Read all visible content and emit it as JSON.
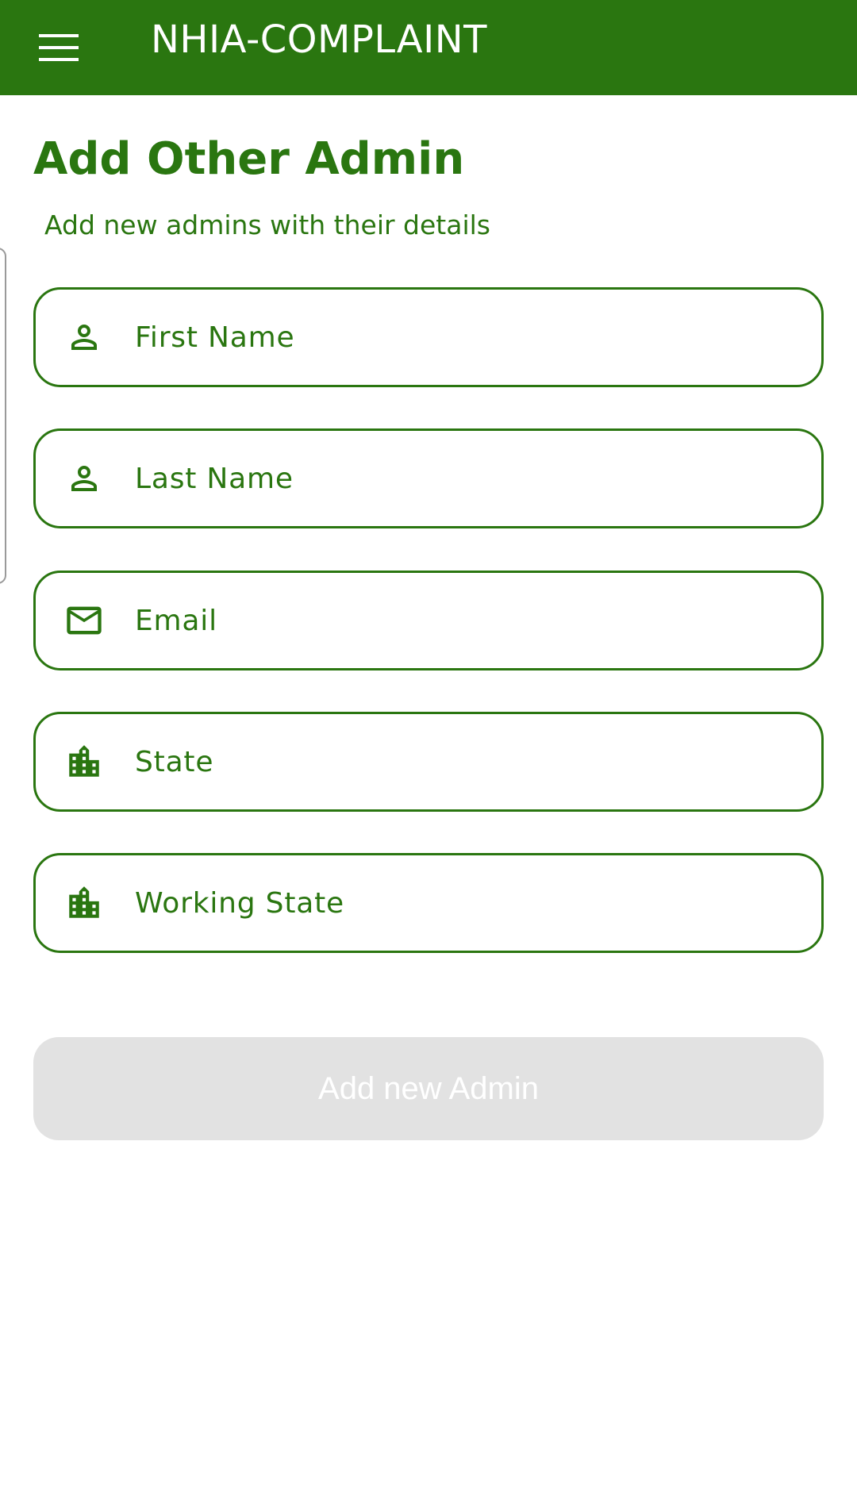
{
  "appbar": {
    "title": "NHIA-COMPLAINT",
    "menu_icon": "hamburger-menu-icon",
    "background": "#2a7610"
  },
  "page": {
    "title": "Add Other Admin",
    "subtitle": "Add new admins with their details"
  },
  "form": {
    "fields": [
      {
        "icon": "person-icon",
        "placeholder": "First Name",
        "value": ""
      },
      {
        "icon": "person-icon",
        "placeholder": "Last Name",
        "value": ""
      },
      {
        "icon": "mail-icon",
        "placeholder": "Email",
        "value": ""
      },
      {
        "icon": "city-icon",
        "placeholder": "State",
        "value": ""
      },
      {
        "icon": "city-icon",
        "placeholder": "Working State",
        "value": ""
      }
    ],
    "submit_label": "Add new Admin",
    "submit_state": "disabled"
  },
  "colors": {
    "accent": "#2a7610",
    "button_disabled": "#e2e2e2",
    "button_text": "#ffffff"
  }
}
